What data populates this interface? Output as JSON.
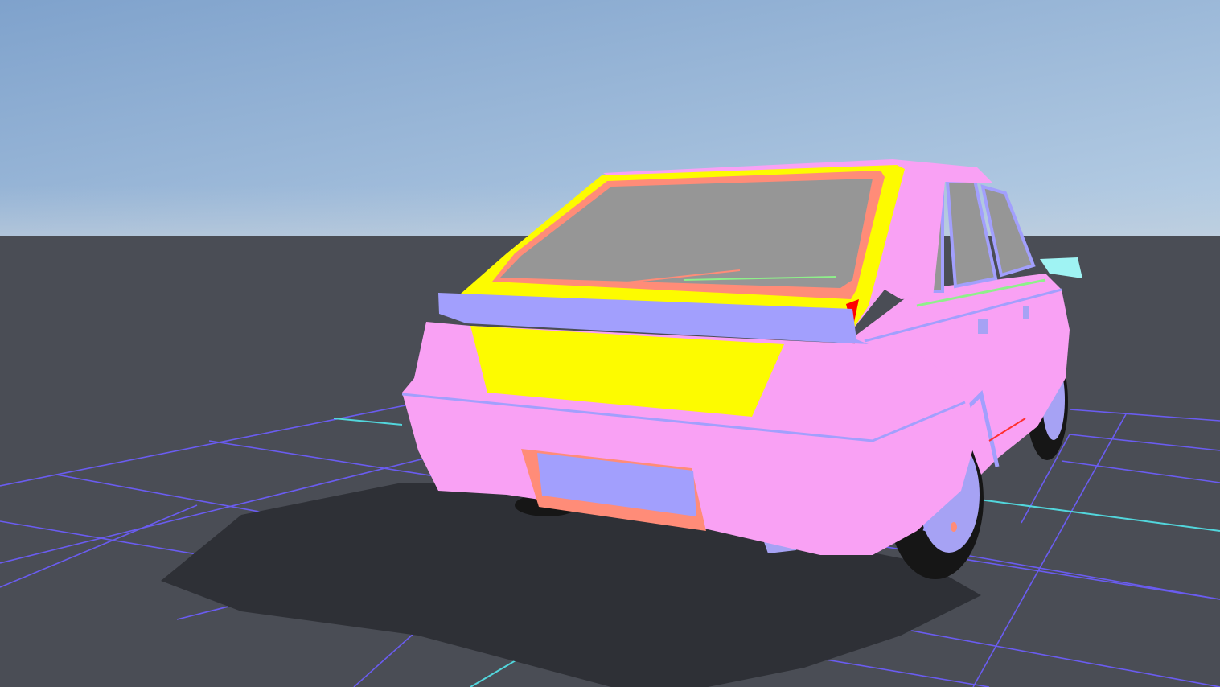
{
  "scene": {
    "sky_top": "#7fa2cc",
    "sky_bottom": "#b8cfe5",
    "ground": "#4a4d55",
    "grid_line": "#6a5cf0",
    "axis_line": "#52d6dc",
    "shadow": "#2e3036"
  },
  "car": {
    "body_color": "#f9a1f4",
    "glass_color": "#969696",
    "trim_color": "#a29ffd",
    "highlight_color": "#fdfb00",
    "accent_color": "#ff8c78",
    "tire_color": "#161616",
    "rim_color": "#a6a2f4"
  },
  "toolbar": {
    "tabs": [
      {
        "name": "tab-1",
        "active": false
      },
      {
        "name": "tab-2",
        "active": false
      },
      {
        "name": "tab-3",
        "active": true
      }
    ]
  }
}
